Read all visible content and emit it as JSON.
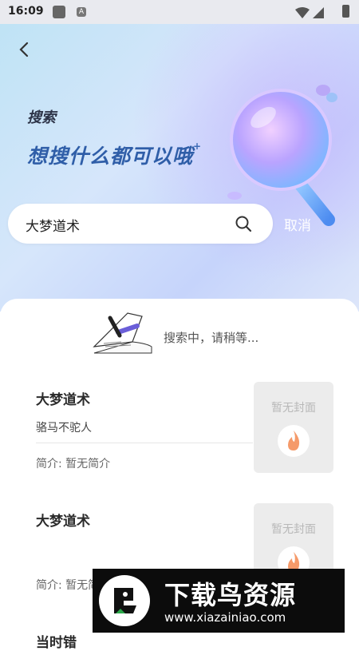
{
  "status_bar": {
    "time": "16:09",
    "notification_letter": "A"
  },
  "header": {
    "title_small": "搜索",
    "title_big": "想搜什么都可以哦",
    "star": "+"
  },
  "search": {
    "value": "大梦道术",
    "cancel_label": "取消"
  },
  "loading": {
    "text": "搜索中，请稍等..."
  },
  "results": [
    {
      "title": "大梦道术",
      "author": "骆马不驼人",
      "intro": "简介: 暂无简介",
      "cover_label": "暂无封面"
    },
    {
      "title": "大梦道术",
      "author": "",
      "intro": "简介: 暂无简介",
      "cover_label": "暂无封面"
    },
    {
      "title": "当时错",
      "author": "",
      "intro": "",
      "cover_label": ""
    }
  ],
  "watermark": {
    "title": "下载鸟资源",
    "url": "www.xiazainiao.com"
  },
  "colors": {
    "accent_blue": "#2f5ea8",
    "hero_gradient_start": "#bfe3f5",
    "hero_gradient_end": "#dde6fa"
  }
}
